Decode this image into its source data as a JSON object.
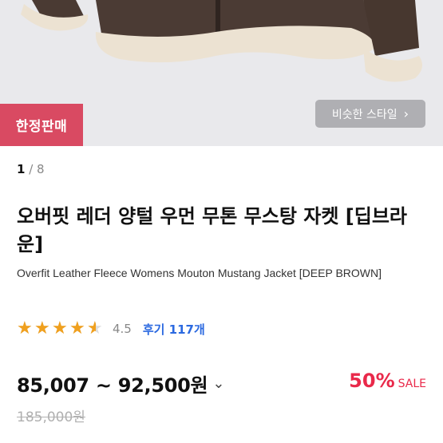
{
  "badge": {
    "label": "한정판매"
  },
  "similar_style": {
    "label": "비슷한 스타일",
    "icon": "chevron-right-icon"
  },
  "pager": {
    "current": "1",
    "separator": " / ",
    "total": "8"
  },
  "product": {
    "title": "오버핏 레더 양털 우먼 무톤 무스탕 자켓 [딥브라운]",
    "subtitle": "Overfit Leather Fleece Womens Mouton Mustang Jacket [DEEP BROWN]"
  },
  "rating": {
    "score": 4.5,
    "score_text": "4.5",
    "reviews_text": "후기 117개"
  },
  "price": {
    "range": "85,007 ~ 92,500원",
    "discount_pct": "50%",
    "sale_label": "SALE",
    "original": "185,000원"
  },
  "colors": {
    "badge_bg": "#d94a62",
    "star": "#f0a01e",
    "link": "#2b69e0",
    "sale": "#e9294a",
    "jacket": "#4a3a33",
    "fleece": "#ece2d2"
  }
}
